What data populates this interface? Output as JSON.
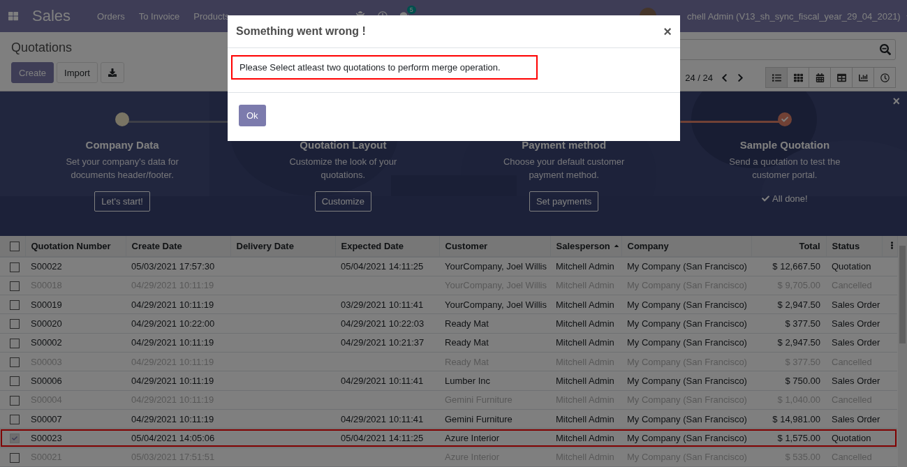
{
  "navbar": {
    "app": "Sales",
    "menu": [
      "Orders",
      "To Invoice",
      "Products"
    ],
    "chat_count": "5",
    "user": "chell Admin (V13_sh_sync_fiscal_year_29_04_2021)"
  },
  "control_panel": {
    "title": "Quotations",
    "buttons": [
      {
        "label": "Create",
        "kind": "primary"
      },
      {
        "label": "Import",
        "kind": "secondary"
      }
    ],
    "pager": "24 / 24",
    "views": [
      {
        "kind": "list",
        "selected": true
      },
      {
        "kind": "kanban",
        "selected": false
      },
      {
        "kind": "calendar",
        "selected": false
      },
      {
        "kind": "pivot",
        "selected": false
      },
      {
        "kind": "graph",
        "selected": false
      },
      {
        "kind": "activity",
        "selected": false
      }
    ]
  },
  "banner": {
    "close": "×",
    "steps": [
      {
        "title": "Company Data",
        "text": "Set your company's data for documents header/footer.",
        "action": "Let's start!",
        "done": false
      },
      {
        "title": "Quotation Layout",
        "text": "Customize the look of your quotations.",
        "action": "Customize",
        "done": false
      },
      {
        "title": "Payment method",
        "text": "Choose your default customer payment method.",
        "action": "Set payments",
        "done": false
      },
      {
        "title": "Sample Quotation",
        "text": "Send a quotation to test the customer portal.",
        "action": "All done!",
        "done": true
      }
    ]
  },
  "table": {
    "all_checked": false,
    "columns": [
      {
        "label": "Quotation Number",
        "sorted": false
      },
      {
        "label": "Create Date",
        "sorted": false
      },
      {
        "label": "Delivery Date",
        "sorted": false
      },
      {
        "label": "Expected Date",
        "sorted": false
      },
      {
        "label": "Customer",
        "sorted": false
      },
      {
        "label": "Salesperson",
        "sorted": true
      },
      {
        "label": "Company",
        "sorted": false
      },
      {
        "label": "Total",
        "sorted": false
      },
      {
        "label": "Status",
        "sorted": false
      }
    ],
    "rows": [
      {
        "cells": [
          "S00022",
          "05/03/2021 17:57:30",
          "",
          "05/04/2021 14:11:25",
          "YourCompany, Joel Willis",
          "Mitchell Admin",
          "My Company (San Francisco)",
          "$ 12,667.50",
          "Quotation"
        ],
        "muted": false,
        "checked": false,
        "highlighted": false
      },
      {
        "cells": [
          "S00018",
          "04/29/2021 10:11:19",
          "",
          "",
          "YourCompany, Joel Willis",
          "Mitchell Admin",
          "My Company (San Francisco)",
          "$ 9,705.00",
          "Cancelled"
        ],
        "muted": true,
        "checked": false,
        "highlighted": false
      },
      {
        "cells": [
          "S00019",
          "04/29/2021 10:11:19",
          "",
          "03/29/2021 10:11:41",
          "YourCompany, Joel Willis",
          "Mitchell Admin",
          "My Company (San Francisco)",
          "$ 2,947.50",
          "Sales Order"
        ],
        "muted": false,
        "checked": false,
        "highlighted": false
      },
      {
        "cells": [
          "S00020",
          "04/29/2021 10:22:00",
          "",
          "04/29/2021 10:22:03",
          "Ready Mat",
          "Mitchell Admin",
          "My Company (San Francisco)",
          "$ 377.50",
          "Sales Order"
        ],
        "muted": false,
        "checked": false,
        "highlighted": false
      },
      {
        "cells": [
          "S00002",
          "04/29/2021 10:11:19",
          "",
          "04/29/2021 10:21:37",
          "Ready Mat",
          "Mitchell Admin",
          "My Company (San Francisco)",
          "$ 2,947.50",
          "Sales Order"
        ],
        "muted": false,
        "checked": false,
        "highlighted": false
      },
      {
        "cells": [
          "S00003",
          "04/29/2021 10:11:19",
          "",
          "",
          "Ready Mat",
          "Mitchell Admin",
          "My Company (San Francisco)",
          "$ 377.50",
          "Cancelled"
        ],
        "muted": true,
        "checked": false,
        "highlighted": false
      },
      {
        "cells": [
          "S00006",
          "04/29/2021 10:11:19",
          "",
          "04/29/2021 10:11:41",
          "Lumber Inc",
          "Mitchell Admin",
          "My Company (San Francisco)",
          "$ 750.00",
          "Sales Order"
        ],
        "muted": false,
        "checked": false,
        "highlighted": false
      },
      {
        "cells": [
          "S00004",
          "04/29/2021 10:11:19",
          "",
          "",
          "Gemini Furniture",
          "Mitchell Admin",
          "My Company (San Francisco)",
          "$ 1,040.00",
          "Cancelled"
        ],
        "muted": true,
        "checked": false,
        "highlighted": false
      },
      {
        "cells": [
          "S00007",
          "04/29/2021 10:11:19",
          "",
          "04/29/2021 10:11:41",
          "Gemini Furniture",
          "Mitchell Admin",
          "My Company (San Francisco)",
          "$ 14,981.00",
          "Sales Order"
        ],
        "muted": false,
        "checked": false,
        "highlighted": false
      },
      {
        "cells": [
          "S00023",
          "05/04/2021 14:05:06",
          "",
          "05/04/2021 14:11:25",
          "Azure Interior",
          "Mitchell Admin",
          "My Company (San Francisco)",
          "$ 1,575.00",
          "Quotation"
        ],
        "muted": false,
        "checked": true,
        "highlighted": true
      },
      {
        "cells": [
          "S00021",
          "05/03/2021 17:51:51",
          "",
          "",
          "Azure Interior",
          "Mitchell Admin",
          "My Company (San Francisco)",
          "$ 535.00",
          "Cancelled"
        ],
        "muted": true,
        "checked": false,
        "highlighted": false
      }
    ]
  },
  "dialog": {
    "title": "Something went wrong !",
    "close": "×",
    "message": "Please Select atleast two quotations to perform merge operation.",
    "message_highlighted": true,
    "button": "Ok"
  }
}
